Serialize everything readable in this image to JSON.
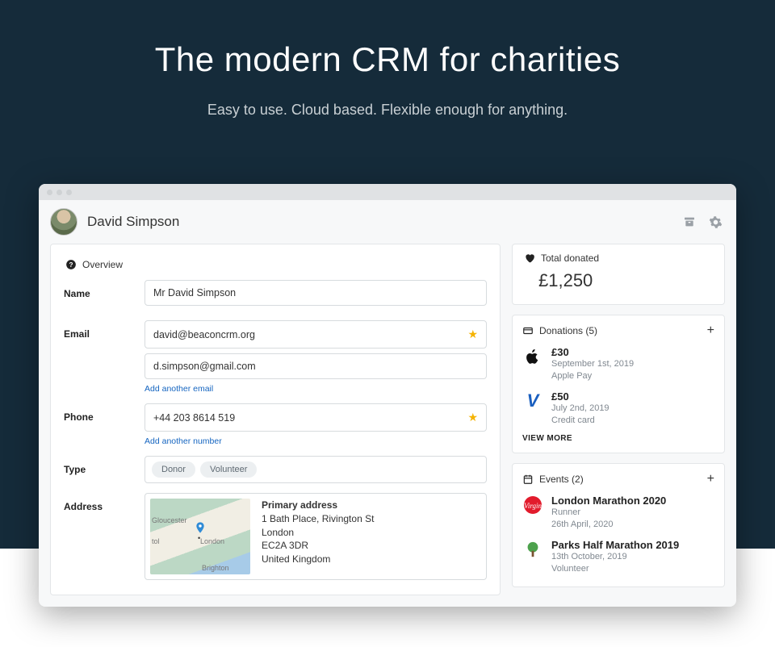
{
  "hero": {
    "title": "The modern CRM for charities",
    "subtitle": "Easy to use. Cloud based. Flexible enough for anything."
  },
  "header": {
    "person_name": "David Simpson"
  },
  "overview": {
    "section_label": "Overview",
    "labels": {
      "name": "Name",
      "email": "Email",
      "phone": "Phone",
      "type": "Type",
      "address": "Address"
    },
    "name_value": "Mr David Simpson",
    "emails": [
      {
        "value": "david@beaconcrm.org",
        "starred": true
      },
      {
        "value": "d.simpson@gmail.com",
        "starred": false
      }
    ],
    "add_email": "Add another email",
    "phones": [
      {
        "value": "+44 203 8614 519",
        "starred": true
      }
    ],
    "add_phone": "Add another number",
    "tags": [
      "Donor",
      "Volunteer"
    ],
    "address": {
      "title": "Primary address",
      "line1": "1 Bath Place, Rivington St",
      "line2": "London",
      "line3": "EC2A 3DR",
      "line4": "United Kingdom"
    },
    "map_cities": {
      "gloucester": "Gloucester",
      "bristol": "tol",
      "london": "London",
      "brighton": "Brighton"
    }
  },
  "total": {
    "label": "Total donated",
    "value": "£1,250"
  },
  "donations": {
    "header": "Donations (5)",
    "items": [
      {
        "amount": "£30",
        "date": "September 1st, 2019",
        "method": "Apple Pay",
        "icon": "apple"
      },
      {
        "amount": "£50",
        "date": "July 2nd, 2019",
        "method": "Credit card",
        "icon": "visa"
      }
    ],
    "view_more": "VIEW MORE"
  },
  "events": {
    "header": "Events (2)",
    "items": [
      {
        "title": "London Marathon 2020",
        "role": "Runner",
        "date": "26th April, 2020",
        "icon": "virgin"
      },
      {
        "title": "Parks Half Marathon 2019",
        "role": "Volunteer",
        "date": "13th October, 2019",
        "icon": "tree"
      }
    ]
  }
}
